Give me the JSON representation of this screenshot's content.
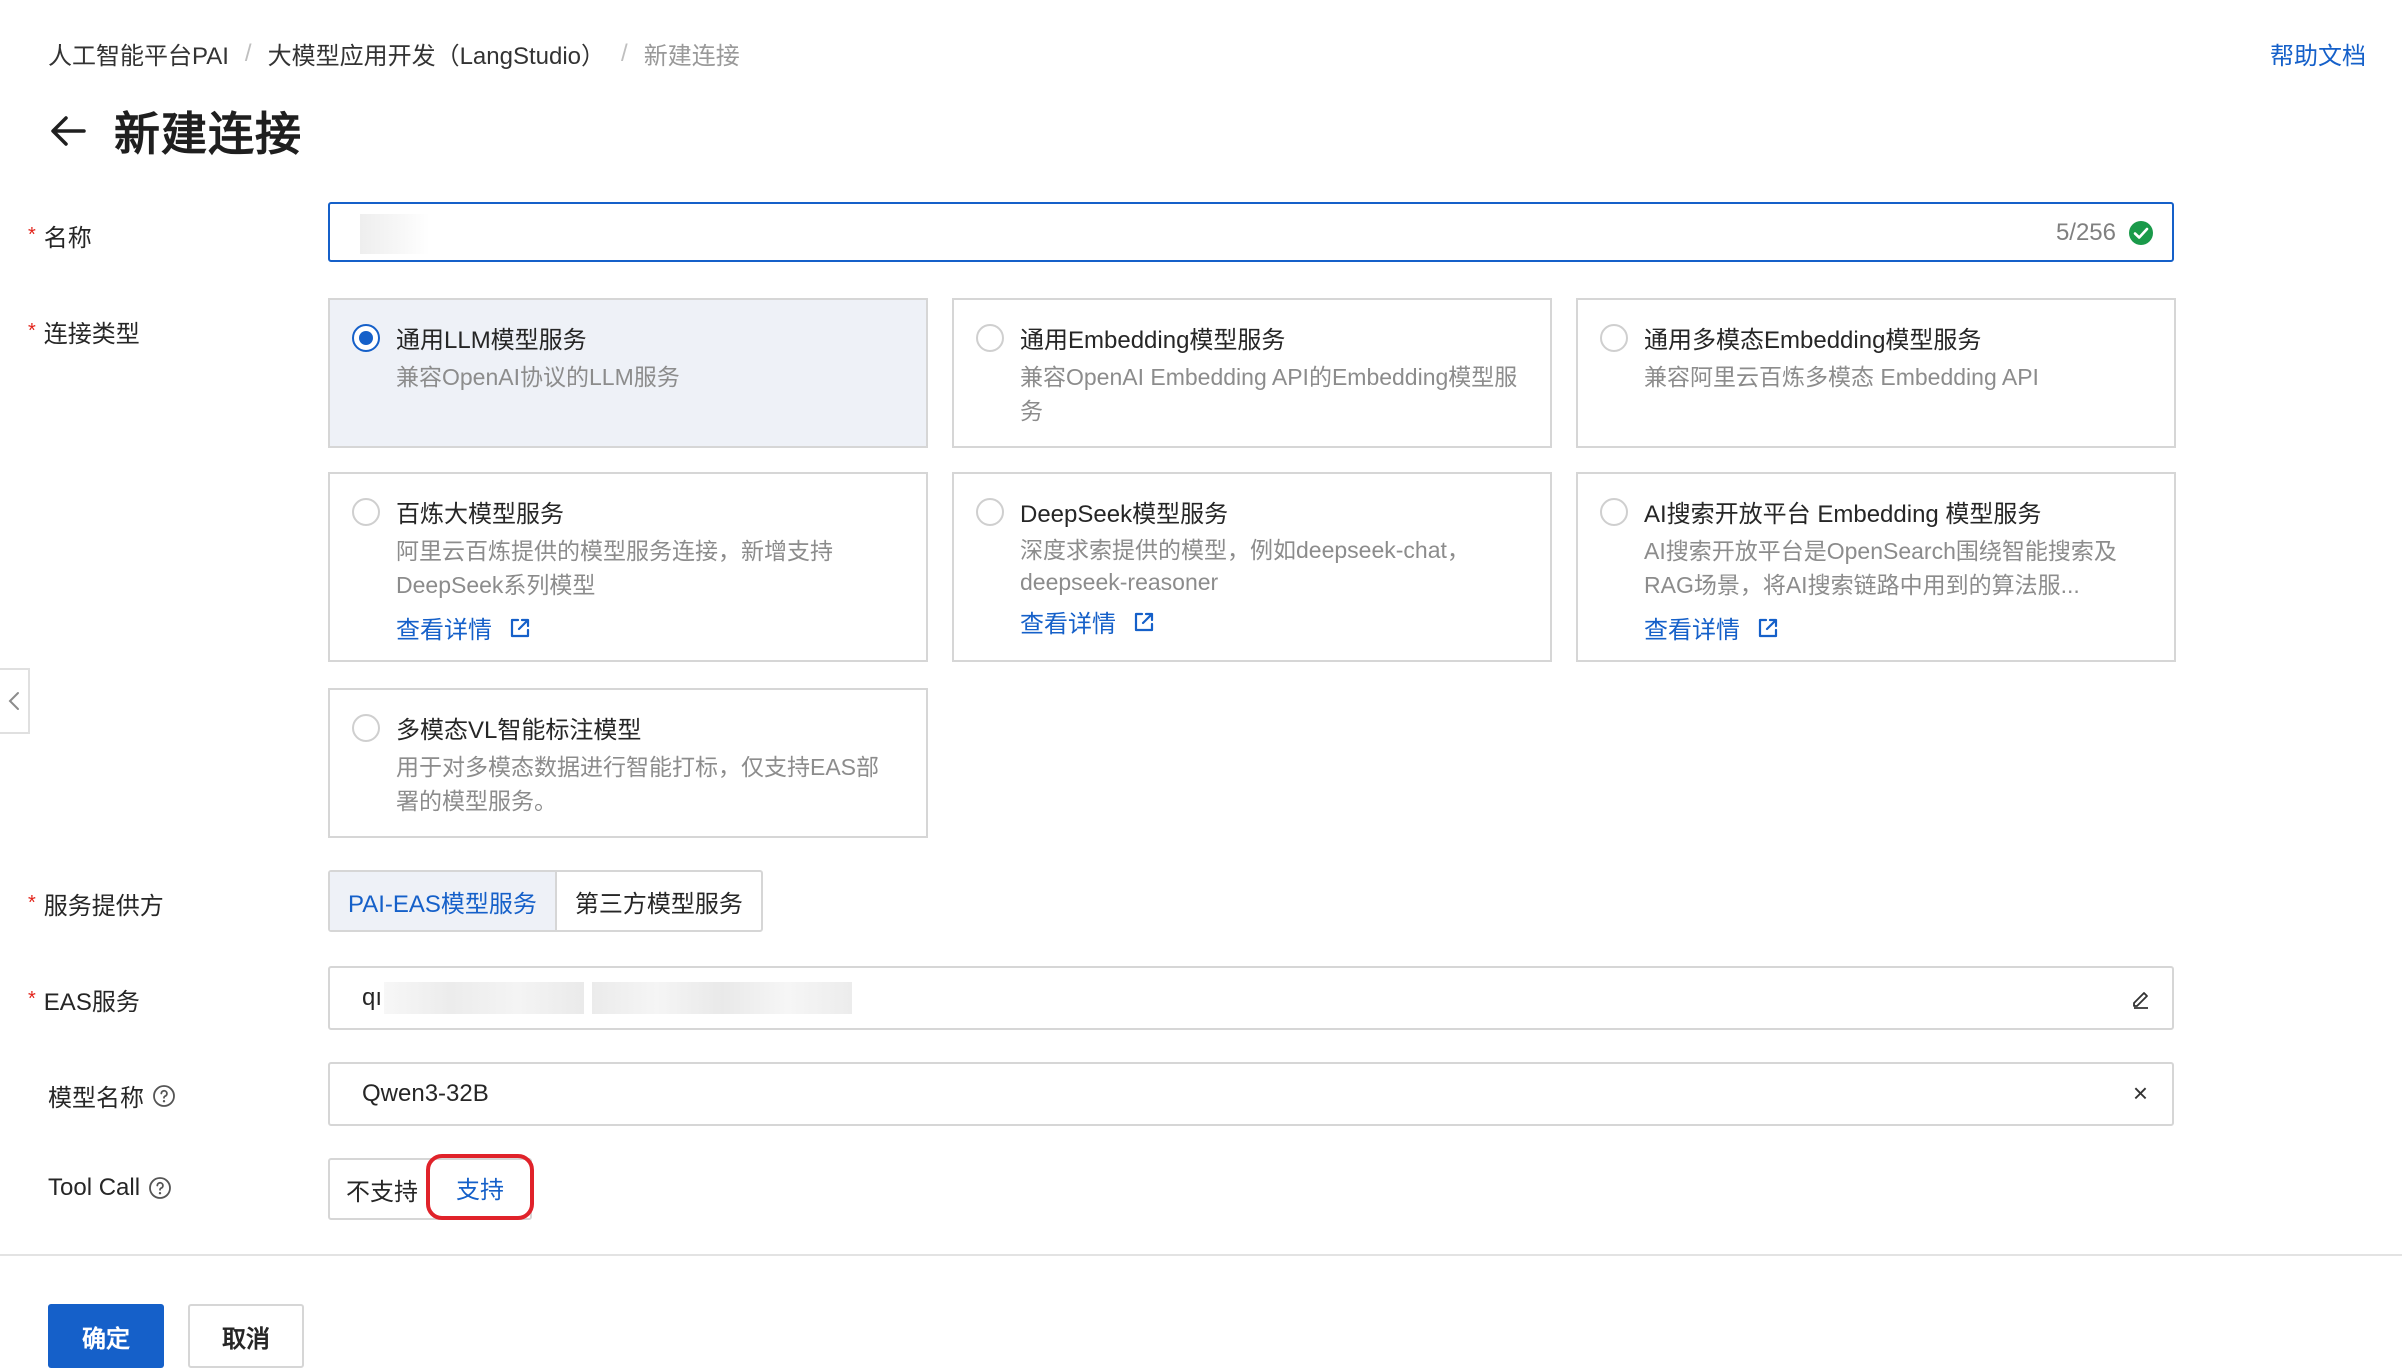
{
  "breadcrumb": [
    "人工智能平台PAI",
    "大模型应用开发（LangStudio）",
    "新建连接"
  ],
  "help_link": "帮助文档",
  "page_title": "新建连接",
  "form": {
    "name": {
      "label": "名称",
      "counter": "5/256"
    },
    "connection_type": {
      "label": "连接类型",
      "options": [
        {
          "title": "通用LLM模型服务",
          "desc": "兼容OpenAI协议的LLM服务",
          "selected": true
        },
        {
          "title": "通用Embedding模型服务",
          "desc": "兼容OpenAI Embedding API的Embedding模型服务",
          "selected": false
        },
        {
          "title": "通用多模态Embedding模型服务",
          "desc": "兼容阿里云百炼多模态 Embedding API",
          "selected": false
        },
        {
          "title": "百炼大模型服务",
          "desc": "阿里云百炼提供的模型服务连接，新增支持DeepSeek系列模型",
          "link": "查看详情",
          "selected": false
        },
        {
          "title": "DeepSeek模型服务",
          "desc": "深度求索提供的模型，例如deepseek-chat，deepseek-reasoner",
          "link": "查看详情",
          "selected": false
        },
        {
          "title": "AI搜索开放平台 Embedding 模型服务",
          "desc": "AI搜索开放平台是OpenSearch围绕智能搜索及RAG场景，将AI搜索链路中用到的算法服...",
          "link": "查看详情",
          "selected": false
        },
        {
          "title": "多模态VL智能标注模型",
          "desc": "用于对多模态数据进行智能打标，仅支持EAS部署的模型服务。",
          "selected": false
        }
      ]
    },
    "provider": {
      "label": "服务提供方",
      "options": [
        "PAI-EAS模型服务",
        "第三方模型服务"
      ],
      "selected": "PAI-EAS模型服务"
    },
    "eas_service": {
      "label": "EAS服务",
      "value": "qı"
    },
    "model_name": {
      "label": "模型名称",
      "value": "Qwen3-32B",
      "clear": "×"
    },
    "tool_call": {
      "label": "Tool Call",
      "options": [
        "不支持",
        "支持"
      ],
      "selected": "支持"
    }
  },
  "actions": {
    "confirm": "确定",
    "cancel": "取消"
  },
  "icons": [
    "back-arrow-icon",
    "check-circle-icon",
    "external-link-icon",
    "edit-icon",
    "question-icon",
    "chevron-left-icon"
  ],
  "colors": {
    "primary": "#1560c9",
    "highlight_ring": "#e0222a",
    "success": "#1a9a4a",
    "required": "#e2231a"
  }
}
